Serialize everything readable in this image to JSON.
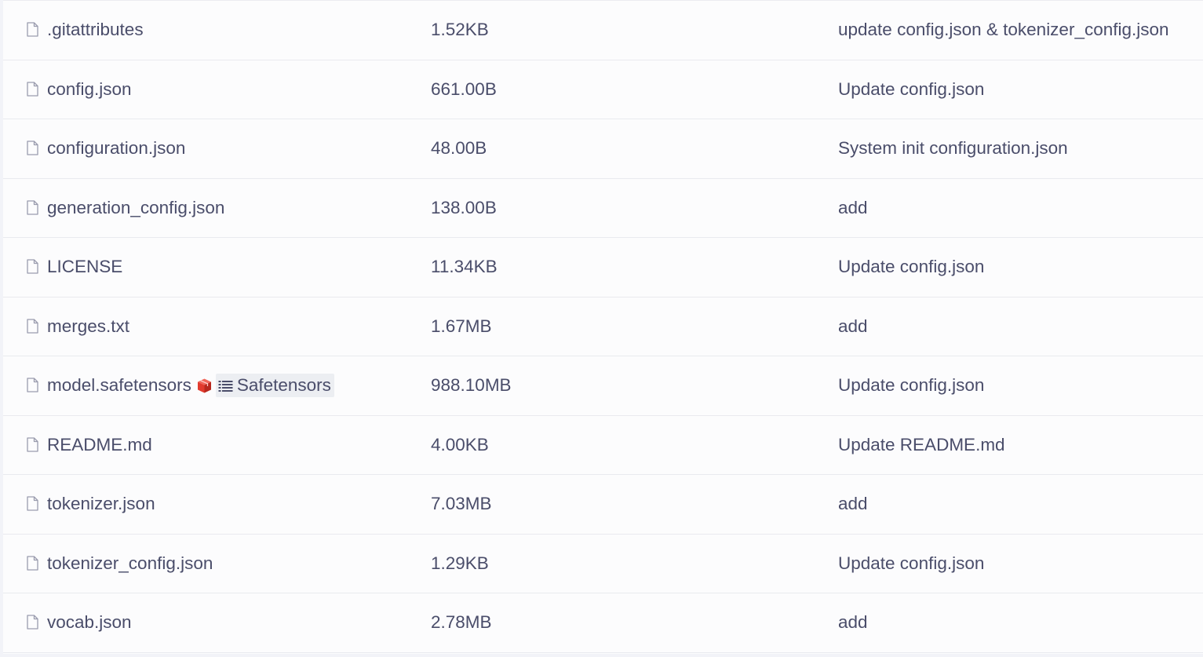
{
  "files": [
    {
      "name": ".gitattributes",
      "size": "1.52KB",
      "commit": "update config.json & tokenizer_config.json"
    },
    {
      "name": "config.json",
      "size": "661.00B",
      "commit": "Update config.json"
    },
    {
      "name": "configuration.json",
      "size": "48.00B",
      "commit": "System init configuration.json"
    },
    {
      "name": "generation_config.json",
      "size": "138.00B",
      "commit": "add"
    },
    {
      "name": "LICENSE",
      "size": "11.34KB",
      "commit": "Update config.json"
    },
    {
      "name": "merges.txt",
      "size": "1.67MB",
      "commit": "add"
    },
    {
      "name": "model.safetensors",
      "size": "988.10MB",
      "commit": "Update config.json",
      "tag": "Safetensors"
    },
    {
      "name": "README.md",
      "size": "4.00KB",
      "commit": "Update README.md"
    },
    {
      "name": "tokenizer.json",
      "size": "7.03MB",
      "commit": "add"
    },
    {
      "name": "tokenizer_config.json",
      "size": "1.29KB",
      "commit": "Update config.json"
    },
    {
      "name": "vocab.json",
      "size": "2.78MB",
      "commit": "add"
    }
  ],
  "icons": {
    "file": "file-icon",
    "model": "cube-icon",
    "tag": "list-icon"
  },
  "colors": {
    "text": "#4a4d6a",
    "icon": "#9a9cae",
    "cube_red": "#e23b2e",
    "tag_background": "#eceef2"
  }
}
